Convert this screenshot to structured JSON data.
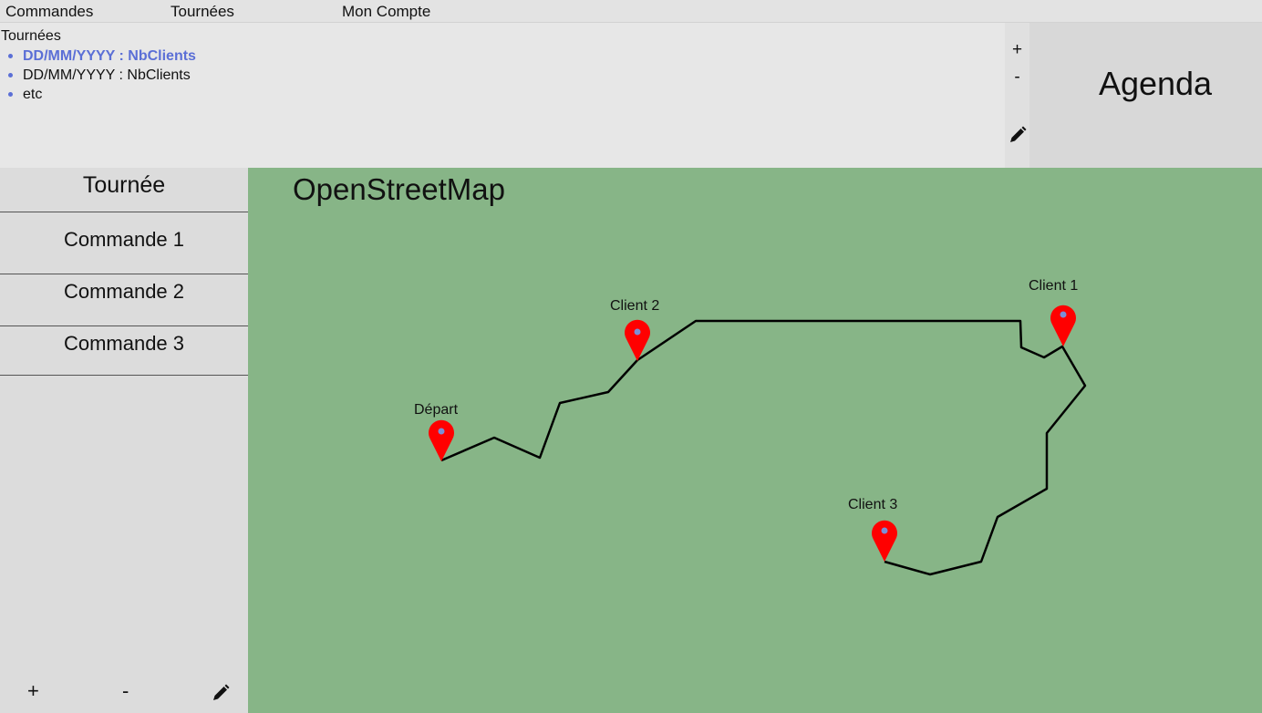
{
  "menu": {
    "orders": "Commandes",
    "tours": "Tournées",
    "account": "Mon Compte"
  },
  "tours_panel": {
    "title": "Tournées",
    "items": [
      {
        "label": "DD/MM/YYYY : NbClients",
        "active": true
      },
      {
        "label": "DD/MM/YYYY : NbClients",
        "active": false
      },
      {
        "label": "etc",
        "active": false
      }
    ],
    "add": "+",
    "remove": "-"
  },
  "agenda": {
    "title": "Agenda"
  },
  "sidebar": {
    "header": "Tournée",
    "orders": [
      "Commande 1",
      "Commande 2",
      "Commande 3"
    ],
    "add": "+",
    "remove": "-"
  },
  "map": {
    "title": "OpenStreetMap",
    "markers": {
      "depart": "Départ",
      "client1": "Client 1",
      "client2": "Client 2",
      "client3": "Client 3"
    },
    "colors": {
      "background": "#87b587",
      "marker": "#ff0000",
      "marker_dot": "#7b8fd6",
      "route": "#000000"
    }
  },
  "icons": {
    "edit": "pencil-icon"
  }
}
